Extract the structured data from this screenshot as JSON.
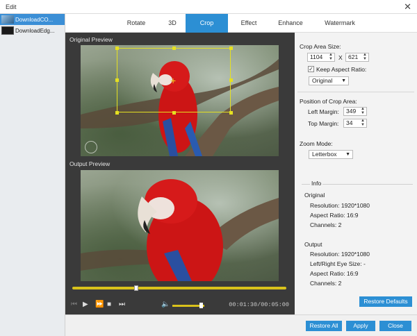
{
  "window": {
    "title": "Edit"
  },
  "files": [
    {
      "name": "DownloadCO..."
    },
    {
      "name": "DownloadEdg..."
    }
  ],
  "tabs": [
    "Rotate",
    "3D",
    "Crop",
    "Effect",
    "Enhance",
    "Watermark"
  ],
  "active_tab": "Crop",
  "preview": {
    "original_label": "Original Preview",
    "output_label": "Output Preview"
  },
  "playback": {
    "timecode": "00:01:30/00:05:00",
    "progress": 0.3,
    "volume": 0.9
  },
  "crop": {
    "area_size_label": "Crop Area Size:",
    "width": "1104",
    "x_sep": "X",
    "height": "621",
    "keep_aspect_label": "Keep Aspect Ratio:",
    "keep_aspect_checked": "✓",
    "aspect_option": "Original",
    "position_label": "Position of Crop Area:",
    "left_margin_label": "Left Margin:",
    "left_margin": "349",
    "top_margin_label": "Top Margin:",
    "top_margin": "34",
    "zoom_mode_label": "Zoom Mode:",
    "zoom_mode": "Letterbox"
  },
  "info": {
    "title": "Info",
    "original_label": "Original",
    "original": {
      "resolution": "Resolution: 1920*1080",
      "aspect": "Aspect Ratio: 16:9",
      "channels": "Channels: 2"
    },
    "output_label": "Output",
    "output": {
      "resolution": "Resolution: 1920*1080",
      "eye_size": "Left/Right Eye Size: -",
      "aspect": "Aspect Ratio: 16:9",
      "channels": "Channels: 2"
    }
  },
  "buttons": {
    "restore_defaults": "Restore Defaults",
    "restore_all": "Restore All",
    "apply": "Apply",
    "close": "Close"
  },
  "colors": {
    "accent": "#2c8fd4",
    "crop_box": "#e5e021",
    "seek": "#d9c21b",
    "parrot": "#d11a1a"
  }
}
